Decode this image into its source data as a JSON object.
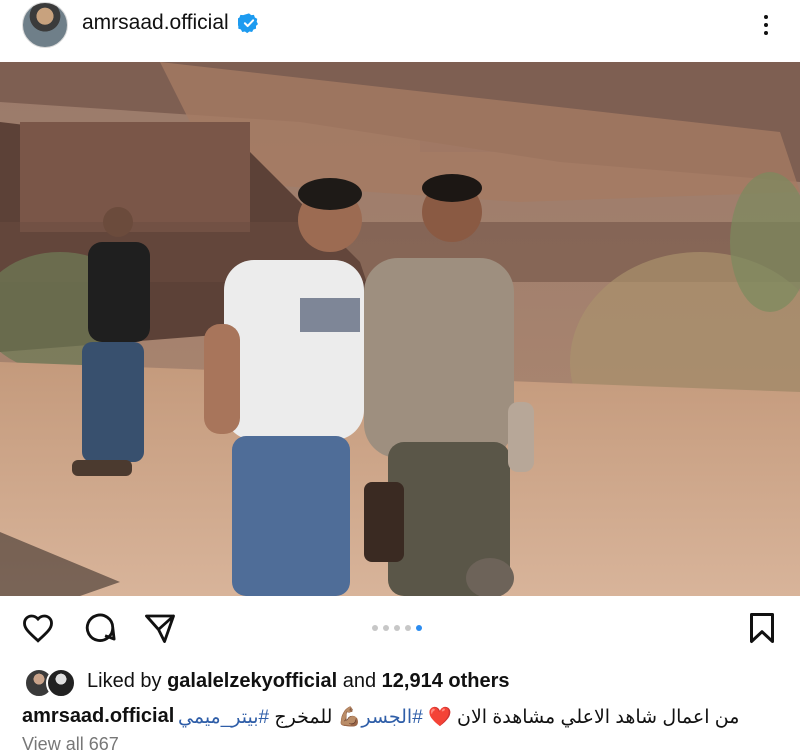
{
  "post": {
    "username": "amrsaad.official",
    "verified_icon": "verified-badge-icon",
    "more_icon": "more-vertical-icon"
  },
  "carousel": {
    "total": 5,
    "active_index": 4
  },
  "actions": {
    "like_icon": "heart-outline-icon",
    "comment_icon": "comment-bubble-icon",
    "share_icon": "send-paper-plane-icon",
    "save_icon": "bookmark-outline-icon"
  },
  "likes": {
    "prefix": "Liked by",
    "user": "galalelzekyofficial",
    "connector": "and",
    "count": "12,914 others"
  },
  "caption": {
    "user": "amrsaad.official",
    "text_part1": "من اعمال شاهد الاعلي مشاهدة الان",
    "emoji1": "❤️",
    "emoji2": "💪🏽",
    "hashtag1": "#الجسر",
    "text_part2": "للمخرج",
    "hashtag2": "#بيتر_ميمي"
  },
  "views": {
    "label": "View all 667"
  },
  "colors": {
    "accent_blue": "#2b8cf0",
    "verified_blue": "#1d9bf0",
    "hashtag": "#2f5ea8"
  }
}
